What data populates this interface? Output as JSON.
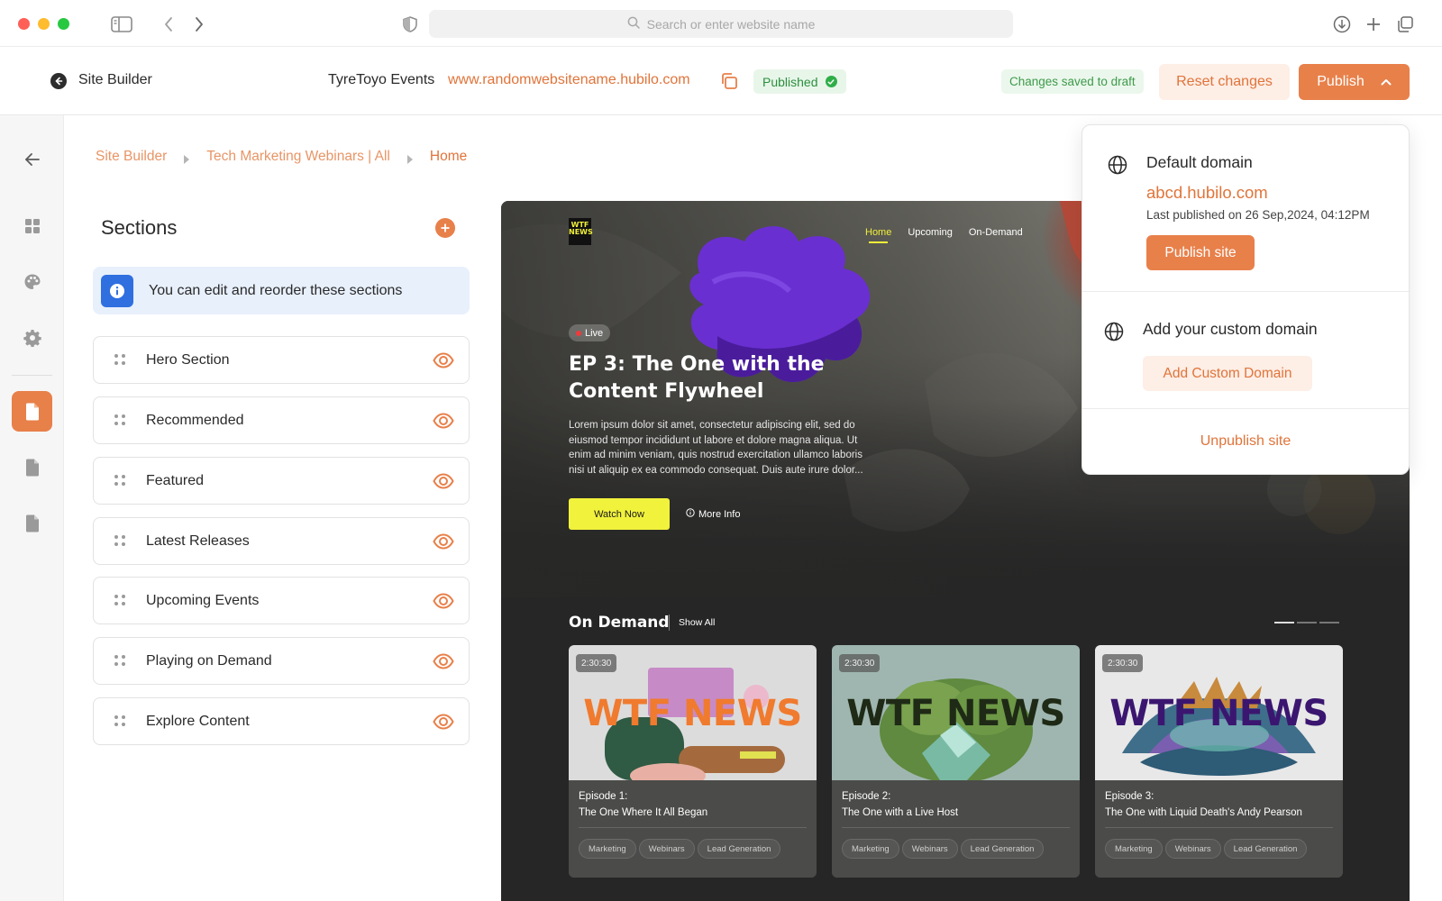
{
  "browser": {
    "url_placeholder": "Search or enter website name",
    "icons": [
      "sidebar-toggle-icon",
      "back-arrow-icon",
      "forward-arrow-icon",
      "shield-icon",
      "search-icon",
      "download-icon",
      "new-tab-icon",
      "tabs-overview-icon"
    ]
  },
  "header": {
    "app_title": "Site Builder",
    "event_name": "TyreToyo Events",
    "site_url": "www.randomwebsitename.hubilo.com",
    "status_badge": "Published",
    "draft_status": "Changes saved to draft",
    "reset_label": "Reset changes",
    "publish_label": "Publish"
  },
  "rail": {
    "items": [
      "back-arrow",
      "dashboard",
      "theme",
      "settings",
      "pages",
      "document",
      "document"
    ]
  },
  "breadcrumb": [
    "Site Builder",
    "Tech Marketing Webinars | All",
    "Home"
  ],
  "sections": {
    "title": "Sections",
    "info": "You can edit and reorder these sections",
    "items": [
      {
        "label": "Hero Section"
      },
      {
        "label": "Recommended"
      },
      {
        "label": "Featured"
      },
      {
        "label": "Latest Releases"
      },
      {
        "label": "Upcoming Events"
      },
      {
        "label": "Playing on Demand"
      },
      {
        "label": "Explore Content"
      }
    ]
  },
  "preview": {
    "logo_text": "WTF NEWS",
    "nav": [
      "Home",
      "Upcoming",
      "On-Demand"
    ],
    "live_label": "Live",
    "hero_title": "EP 3: The One with the Content Flywheel",
    "hero_desc": "Lorem ipsum dolor sit amet, consectetur adipiscing elit, sed do eiusmod tempor incididunt ut labore et dolore magna aliqua. Ut enim ad minim veniam, quis nostrud exercitation ullamco laboris nisi ut aliquip ex ea commodo consequat. Duis aute irure dolor...",
    "watch_label": "Watch Now",
    "more_info_label": "More Info",
    "on_demand_title": "On Demand",
    "show_all_label": "Show All",
    "cards": [
      {
        "time": "2:30:30",
        "brand": "WTF NEWS",
        "episode": "Episode 1:",
        "name": "The One Where It All Began",
        "tags": [
          "Marketing",
          "Webinars",
          "Lead Generation"
        ],
        "brand_color": "#f07a2e"
      },
      {
        "time": "2:30:30",
        "brand": "WTF NEWS",
        "episode": "Episode 2:",
        "name": "The One with a Live Host",
        "tags": [
          "Marketing",
          "Webinars",
          "Lead Generation"
        ],
        "brand_color": "#1f2a16"
      },
      {
        "time": "2:30:30",
        "brand": "WTF NEWS",
        "episode": "Episode 3:",
        "name": "The One with Liquid Death's Andy Pearson",
        "tags": [
          "Marketing",
          "Webinars",
          "Lead Generation"
        ],
        "brand_color": "#3b1670"
      }
    ]
  },
  "publish_dropdown": {
    "default_title": "Default domain",
    "default_domain": "abcd.hubilo.com",
    "last_published": "Last published on 26 Sep,2024, 04:12PM",
    "publish_site_label": "Publish site",
    "custom_title": "Add your custom domain",
    "add_custom_label": "Add Custom Domain",
    "unpublish_label": "Unpublish site"
  },
  "colors": {
    "accent": "#e8804a",
    "accent_text": "#e0743a",
    "success": "#2fae48",
    "info": "#2f6fe0",
    "watch_button": "#f1f23c"
  }
}
